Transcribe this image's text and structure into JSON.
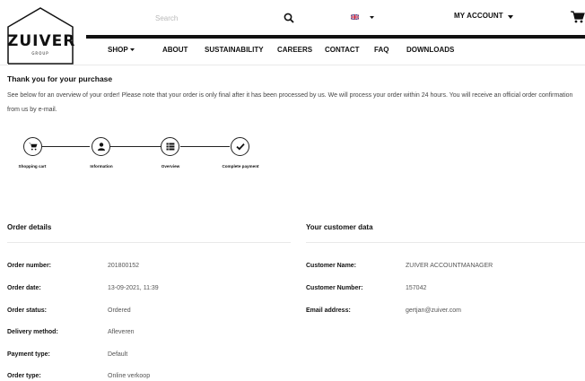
{
  "header": {
    "logo": {
      "text": "ZUIVER",
      "subtext": "GROUP"
    },
    "search": {
      "placeholder": "Search",
      "value": ""
    },
    "language": {
      "flag": "uk-flag-icon"
    },
    "account_label": "MY ACCOUNT",
    "cart_icon": "cart-icon"
  },
  "nav": {
    "items": [
      {
        "label": "SHOP",
        "has_dropdown": true
      },
      {
        "label": "ABOUT"
      },
      {
        "label": "SUSTAINABILITY"
      },
      {
        "label": "CAREERS"
      },
      {
        "label": "CONTACT"
      },
      {
        "label": "FAQ"
      },
      {
        "label": "DOWNLOADS"
      }
    ]
  },
  "page": {
    "title": "Thank you for your purchase",
    "intro": "See below for an overview of your order! Please note that your order is only final after it has been processed by us. We will process your order within 24 hours. You will receive an official order confirmation from us by e-mail."
  },
  "steps": [
    {
      "label": "Shopping cart",
      "icon": "cart-icon"
    },
    {
      "label": "Information",
      "icon": "user-icon"
    },
    {
      "label": "Overview",
      "icon": "list-icon"
    },
    {
      "label": "Complete payment",
      "icon": "check-icon"
    }
  ],
  "order_details": {
    "title": "Order details",
    "rows": [
      {
        "label": "Order number:",
        "value": "201800152"
      },
      {
        "label": "Order date:",
        "value": "13-09-2021, 11:39"
      },
      {
        "label": "Order status:",
        "value": "Ordered"
      },
      {
        "label": "Delivery method:",
        "value": "Afleveren"
      },
      {
        "label": "Payment type:",
        "value": "Default"
      },
      {
        "label": "Order type:",
        "value": "Online verkoop"
      }
    ]
  },
  "customer_data": {
    "title": "Your customer data",
    "rows": [
      {
        "label": "Customer Name:",
        "value": "ZUIVER ACCOUNTMANAGER"
      },
      {
        "label": "Customer Number:",
        "value": "157042"
      },
      {
        "label": "Email address:",
        "value": "gertjan@zuiver.com"
      }
    ]
  },
  "colors": {
    "text": "#111111",
    "muted": "#555555",
    "divider": "#e9e9e9",
    "placeholder": "#b9b9b9"
  }
}
